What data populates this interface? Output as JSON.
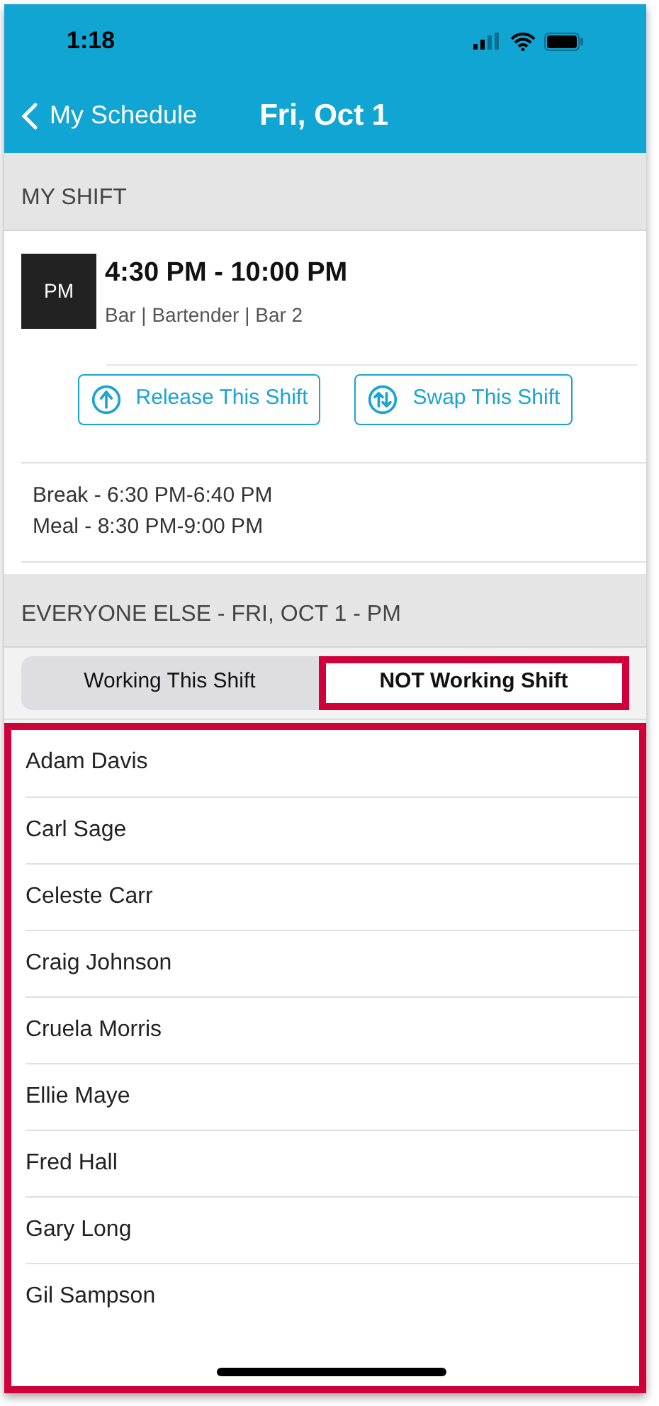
{
  "status_bar": {
    "time": "1:18"
  },
  "nav": {
    "back_label": "My Schedule",
    "title": "Fri, Oct 1"
  },
  "my_shift": {
    "header": "MY SHIFT",
    "badge": "PM",
    "time": "4:30 PM - 10:00 PM",
    "details": "Bar | Bartender | Bar 2",
    "actions": [
      {
        "kind": "release",
        "label": "Release This Shift"
      },
      {
        "kind": "swap",
        "label": "Swap This Shift"
      }
    ],
    "breaks": [
      "Break - 6:30 PM-6:40 PM",
      "Meal - 8:30 PM-9:00 PM"
    ]
  },
  "everyone_else": {
    "header": "EVERYONE ELSE - FRI, OCT 1 - PM",
    "tabs": [
      {
        "label": "Working This Shift",
        "selected": false,
        "highlighted": false
      },
      {
        "label": "NOT Working Shift",
        "selected": true,
        "highlighted": true
      }
    ],
    "list_highlighted": true,
    "people": [
      "Adam Davis",
      "Carl Sage",
      "Celeste Carr",
      "Craig Johnson",
      "Cruela Morris",
      "Ellie Maye",
      "Fred Hall",
      "Gary Long",
      "Gil Sampson"
    ]
  }
}
